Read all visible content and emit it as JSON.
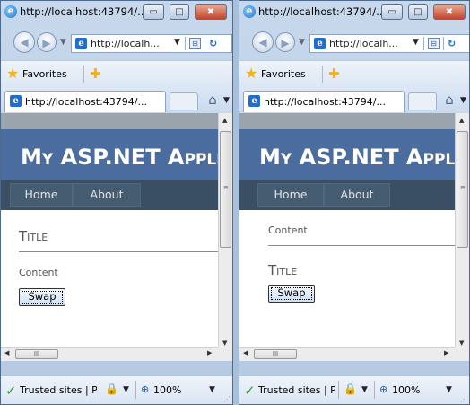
{
  "window_left": {
    "title": "http://localhost:43794/...",
    "address": "http://localh...",
    "favorites_label": "Favorites",
    "tab_title": "http://localhost:43794/...",
    "site_title": "My ASP.NET Appli",
    "menu": [
      "Home",
      "About"
    ],
    "page_title": "Title",
    "content": "Content",
    "swap_label": "Swap",
    "status_zone": "Trusted sites | Pr",
    "zoom": "100%"
  },
  "window_right": {
    "title": "http://localhost:43794/...",
    "address": "http://localh...",
    "favorites_label": "Favorites",
    "tab_title": "http://localhost:43794/...",
    "site_title": "My ASP.NET Appli",
    "menu": [
      "Home",
      "About"
    ],
    "page_title": "Title",
    "content": "Content",
    "swap_label": "Swap",
    "status_zone": "Trusted sites | Pr",
    "zoom": "100%"
  },
  "glyphs": {
    "minimize": "▭",
    "maximize": "□",
    "close": "✖",
    "back": "◀",
    "forward": "▶",
    "dropdown": "▼",
    "star": "★",
    "add_favorite": "✚",
    "home": "⌂",
    "check": "✓",
    "lock": "🔒",
    "zoom": "⊕",
    "scroll_up": "▲",
    "scroll_down": "▼",
    "scroll_left": "◀",
    "scroll_right": "▶",
    "grip_h": "III",
    "grip_v": "≡",
    "refresh": "↻",
    "compat": "⊟",
    "ie": "e"
  },
  "colors": {
    "header": "#4b6c9e",
    "menu": "#465c71",
    "close_button": "#c2452c"
  }
}
